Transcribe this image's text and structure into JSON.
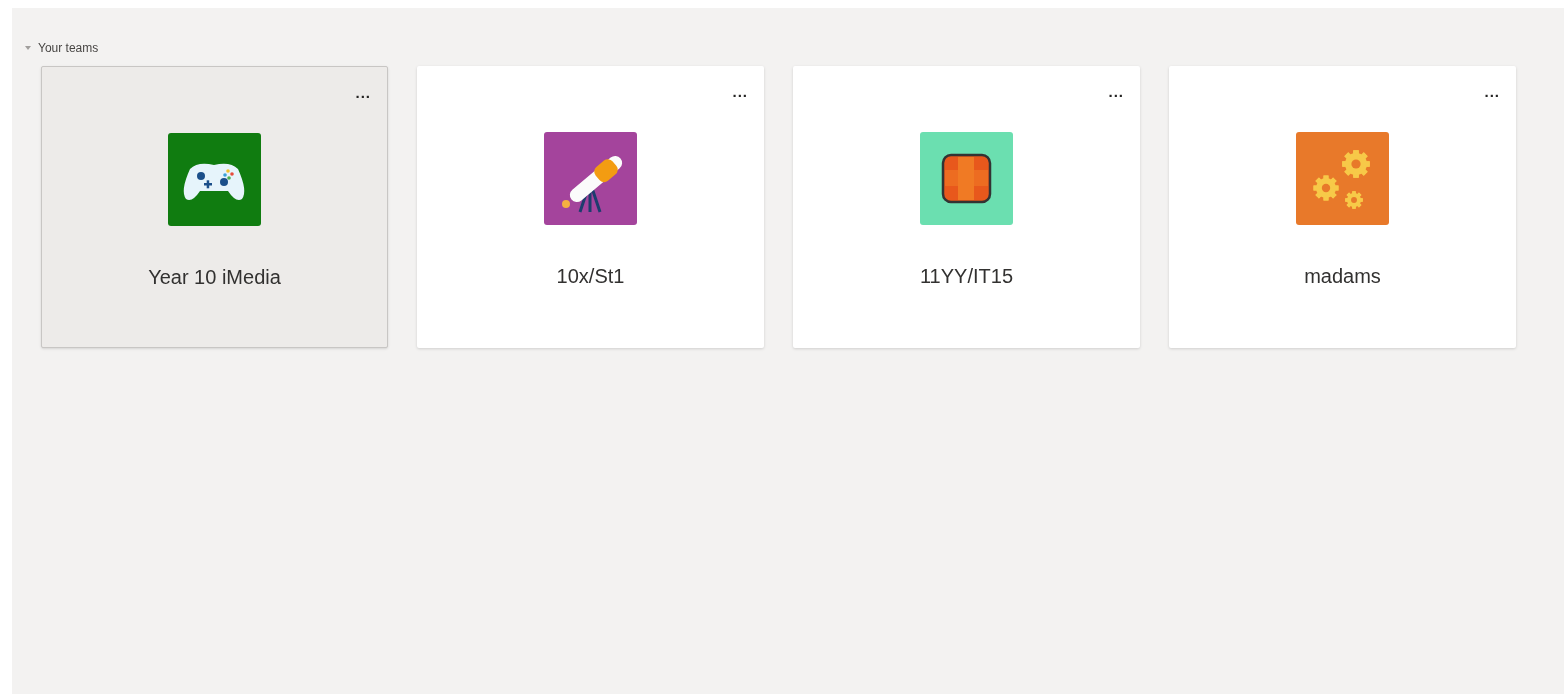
{
  "section": {
    "title": "Your teams",
    "expanded": true
  },
  "teams": [
    {
      "name": "Year 10 iMedia",
      "kind": "gamepad",
      "color": "#107c10",
      "selected": true,
      "menu": "..."
    },
    {
      "name": "10x/St1",
      "kind": "telescope",
      "color": "#a4449c",
      "selected": false,
      "menu": "..."
    },
    {
      "name": "11YY/IT15",
      "kind": "tile",
      "color": "#6bdfb0",
      "selected": false,
      "menu": "..."
    },
    {
      "name": "madams",
      "kind": "gears",
      "color": "#e8792a",
      "selected": false,
      "menu": "..."
    }
  ]
}
